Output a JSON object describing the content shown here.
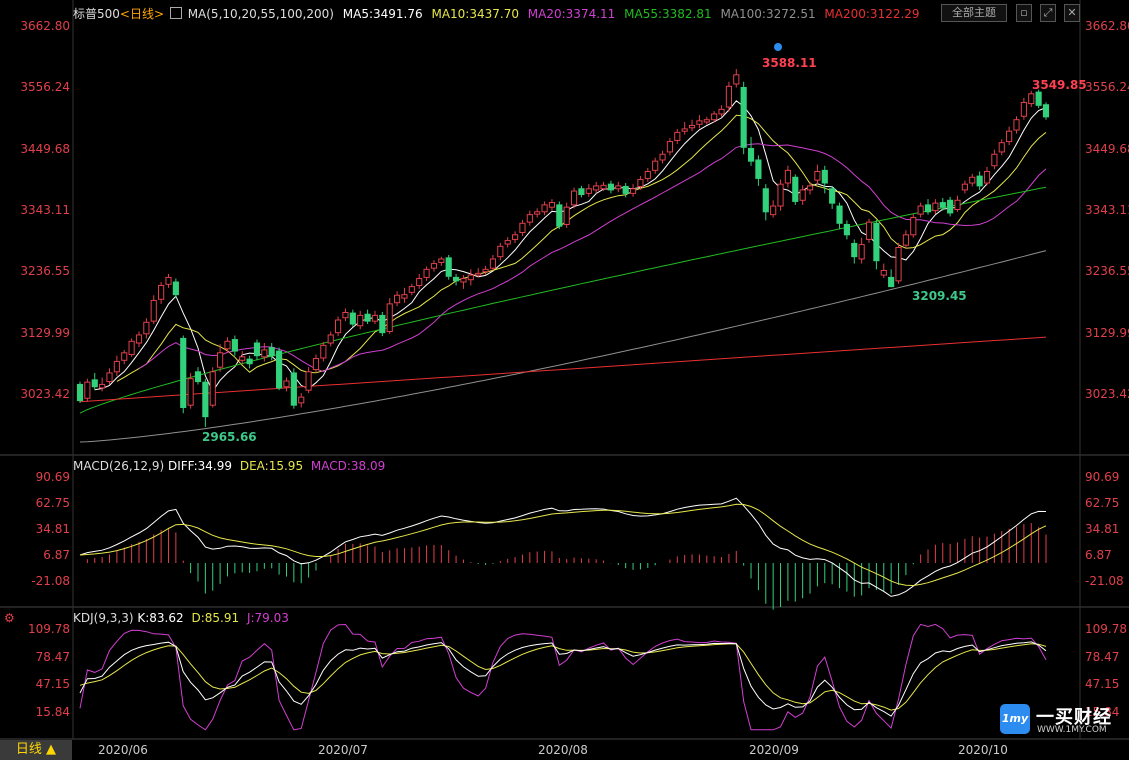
{
  "header": {
    "symbol": "标普500",
    "period": "<日线>",
    "ma_def": "MA(5,10,20,55,100,200)",
    "ma5": "MA5:3491.76",
    "ma10": "MA10:3437.70",
    "ma20": "MA20:3374.11",
    "ma55": "MA55:3382.81",
    "ma100": "MA100:3272.51",
    "ma200": "MA200:3122.29",
    "theme_button": "全部主题",
    "colors": {
      "ma5": "#ffffff",
      "ma10": "#e6e64c",
      "ma20": "#d040d0",
      "ma55": "#22bb22",
      "ma100": "#909090",
      "ma200": "#e83030",
      "up": "#e0404b",
      "down": "#32d17b"
    }
  },
  "price_axis": [
    "3662.80",
    "3556.24",
    "3449.68",
    "3343.11",
    "3236.55",
    "3129.99",
    "3023.42"
  ],
  "macd_panel": {
    "title": "MACD(26,12,9)",
    "diff": "DIFF:34.99",
    "dea": "DEA:15.95",
    "macd": "MACD:38.09",
    "axis": [
      "90.69",
      "62.75",
      "34.81",
      "6.87",
      "-21.08"
    ]
  },
  "kdj_panel": {
    "title": "KDJ(9,3,3)",
    "k": "K:83.62",
    "d": "D:85.91",
    "j": "J:79.03",
    "axis": [
      "109.78",
      "78.47",
      "47.15",
      "15.84"
    ]
  },
  "footer": {
    "period_tab": "日线 ▲",
    "dates": [
      "2020/06",
      "2020/07",
      "2020/08",
      "2020/09",
      "2020/10"
    ]
  },
  "logo": {
    "mark": "1my",
    "name": "一买财经",
    "url": "WWW.1MY.COM"
  },
  "chart_data": {
    "type": "candlestick",
    "title": "标普500 <日线>",
    "annotations": {
      "high": "3588.11",
      "high_right": "3549.85",
      "low_left": "2965.66",
      "low_right": "3209.45"
    },
    "ylim": [
      2950,
      3700
    ],
    "candles": [
      [
        3040,
        3012,
        3045,
        3008
      ],
      [
        3016,
        3044,
        3050,
        3010
      ],
      [
        3048,
        3036,
        3060,
        3030
      ],
      [
        3034,
        3040,
        3052,
        3028
      ],
      [
        3045,
        3060,
        3068,
        3040
      ],
      [
        3062,
        3080,
        3090,
        3055
      ],
      [
        3082,
        3095,
        3100,
        3075
      ],
      [
        3092,
        3115,
        3120,
        3088
      ],
      [
        3112,
        3126,
        3132,
        3105
      ],
      [
        3128,
        3148,
        3155,
        3120
      ],
      [
        3150,
        3186,
        3195,
        3145
      ],
      [
        3188,
        3212,
        3218,
        3180
      ],
      [
        3214,
        3226,
        3232,
        3208
      ],
      [
        3218,
        3196,
        3224,
        3190
      ],
      [
        3120,
        3000,
        3125,
        2990
      ],
      [
        3004,
        3050,
        3060,
        2998
      ],
      [
        3062,
        3045,
        3070,
        3040
      ],
      [
        3044,
        2984,
        3050,
        2966
      ],
      [
        3004,
        3062,
        3070,
        3000
      ],
      [
        3070,
        3095,
        3110,
        3062
      ],
      [
        3102,
        3115,
        3122,
        3095
      ],
      [
        3118,
        3098,
        3125,
        3090
      ],
      [
        3082,
        3088,
        3098,
        3075
      ],
      [
        3084,
        3076,
        3090,
        3068
      ],
      [
        3112,
        3090,
        3118,
        3082
      ],
      [
        3088,
        3100,
        3112,
        3080
      ],
      [
        3104,
        3090,
        3112,
        3082
      ],
      [
        3098,
        3034,
        3104,
        3030
      ],
      [
        3036,
        3046,
        3052,
        3028
      ],
      [
        3060,
        3004,
        3068,
        2998
      ],
      [
        3008,
        3018,
        3025,
        3000
      ],
      [
        3030,
        3062,
        3070,
        3025
      ],
      [
        3066,
        3085,
        3092,
        3060
      ],
      [
        3086,
        3108,
        3114,
        3080
      ],
      [
        3112,
        3126,
        3132,
        3106
      ],
      [
        3130,
        3152,
        3158,
        3124
      ],
      [
        3156,
        3165,
        3172,
        3150
      ],
      [
        3164,
        3145,
        3170,
        3140
      ],
      [
        3142,
        3160,
        3168,
        3136
      ],
      [
        3162,
        3150,
        3170,
        3145
      ],
      [
        3150,
        3160,
        3168,
        3145
      ],
      [
        3160,
        3130,
        3166,
        3124
      ],
      [
        3132,
        3180,
        3190,
        3128
      ],
      [
        3182,
        3195,
        3202,
        3176
      ],
      [
        3190,
        3196,
        3208,
        3182
      ],
      [
        3200,
        3210,
        3215,
        3195
      ],
      [
        3212,
        3224,
        3232,
        3206
      ],
      [
        3226,
        3240,
        3245,
        3220
      ],
      [
        3242,
        3250,
        3256,
        3236
      ],
      [
        3252,
        3258,
        3262,
        3246
      ],
      [
        3260,
        3228,
        3265,
        3222
      ],
      [
        3226,
        3220,
        3232,
        3212
      ],
      [
        3218,
        3224,
        3230,
        3206
      ],
      [
        3222,
        3230,
        3240,
        3212
      ],
      [
        3230,
        3233,
        3242,
        3226
      ],
      [
        3236,
        3240,
        3246,
        3230
      ],
      [
        3242,
        3258,
        3265,
        3238
      ],
      [
        3262,
        3280,
        3286,
        3256
      ],
      [
        3284,
        3290,
        3296,
        3278
      ],
      [
        3292,
        3300,
        3306,
        3286
      ],
      [
        3304,
        3320,
        3326,
        3298
      ],
      [
        3322,
        3335,
        3342,
        3316
      ],
      [
        3336,
        3340,
        3346,
        3330
      ],
      [
        3340,
        3352,
        3358,
        3334
      ],
      [
        3348,
        3356,
        3362,
        3342
      ],
      [
        3352,
        3315,
        3358,
        3310
      ],
      [
        3318,
        3348,
        3356,
        3312
      ],
      [
        3352,
        3376,
        3382,
        3346
      ],
      [
        3380,
        3370,
        3385,
        3365
      ],
      [
        3372,
        3380,
        3388,
        3366
      ],
      [
        3378,
        3385,
        3392,
        3372
      ],
      [
        3380,
        3386,
        3392,
        3376
      ],
      [
        3388,
        3378,
        3394,
        3372
      ],
      [
        3380,
        3385,
        3392,
        3374
      ],
      [
        3384,
        3372,
        3390,
        3365
      ],
      [
        3372,
        3380,
        3388,
        3366
      ],
      [
        3384,
        3396,
        3402,
        3378
      ],
      [
        3398,
        3410,
        3416,
        3392
      ],
      [
        3412,
        3428,
        3434,
        3406
      ],
      [
        3430,
        3440,
        3446,
        3424
      ],
      [
        3444,
        3462,
        3468,
        3438
      ],
      [
        3464,
        3478,
        3484,
        3458
      ],
      [
        3480,
        3484,
        3496,
        3474
      ],
      [
        3486,
        3490,
        3500,
        3480
      ],
      [
        3492,
        3498,
        3508,
        3485
      ],
      [
        3496,
        3500,
        3505,
        3492
      ],
      [
        3500,
        3510,
        3515,
        3495
      ],
      [
        3510,
        3518,
        3525,
        3505
      ],
      [
        3522,
        3558,
        3566,
        3514
      ],
      [
        3562,
        3578,
        3588,
        3556
      ],
      [
        3556,
        3452,
        3566,
        3440
      ],
      [
        3450,
        3428,
        3470,
        3420
      ],
      [
        3430,
        3398,
        3438,
        3385
      ],
      [
        3380,
        3340,
        3388,
        3325
      ],
      [
        3335,
        3350,
        3360,
        3330
      ],
      [
        3350,
        3388,
        3396,
        3342
      ],
      [
        3390,
        3412,
        3420,
        3382
      ],
      [
        3400,
        3358,
        3405,
        3352
      ],
      [
        3360,
        3378,
        3386,
        3352
      ],
      [
        3378,
        3385,
        3392,
        3370
      ],
      [
        3395,
        3410,
        3422,
        3388
      ],
      [
        3412,
        3390,
        3420,
        3372
      ],
      [
        3380,
        3355,
        3385,
        3345
      ],
      [
        3350,
        3320,
        3356,
        3310
      ],
      [
        3318,
        3300,
        3325,
        3292
      ],
      [
        3285,
        3262,
        3292,
        3250
      ],
      [
        3258,
        3283,
        3295,
        3250
      ],
      [
        3292,
        3322,
        3328,
        3286
      ],
      [
        3320,
        3255,
        3326,
        3240
      ],
      [
        3230,
        3238,
        3250,
        3225
      ],
      [
        3226,
        3210,
        3240,
        3209
      ],
      [
        3220,
        3278,
        3286,
        3215
      ],
      [
        3282,
        3300,
        3308,
        3276
      ],
      [
        3300,
        3330,
        3336,
        3295
      ],
      [
        3336,
        3350,
        3356,
        3330
      ],
      [
        3352,
        3340,
        3362,
        3335
      ],
      [
        3342,
        3355,
        3362,
        3336
      ],
      [
        3356,
        3348,
        3364,
        3342
      ],
      [
        3360,
        3338,
        3366,
        3332
      ],
      [
        3344,
        3360,
        3368,
        3340
      ],
      [
        3378,
        3388,
        3394,
        3372
      ],
      [
        3390,
        3400,
        3406,
        3384
      ],
      [
        3402,
        3385,
        3410,
        3378
      ],
      [
        3390,
        3410,
        3418,
        3386
      ],
      [
        3420,
        3440,
        3448,
        3414
      ],
      [
        3444,
        3460,
        3466,
        3438
      ],
      [
        3462,
        3480,
        3488,
        3456
      ],
      [
        3482,
        3500,
        3506,
        3476
      ],
      [
        3506,
        3530,
        3538,
        3500
      ],
      [
        3528,
        3545,
        3550,
        3522
      ],
      [
        3548,
        3525,
        3552,
        3520
      ],
      [
        3526,
        3505,
        3530,
        3500
      ]
    ]
  }
}
